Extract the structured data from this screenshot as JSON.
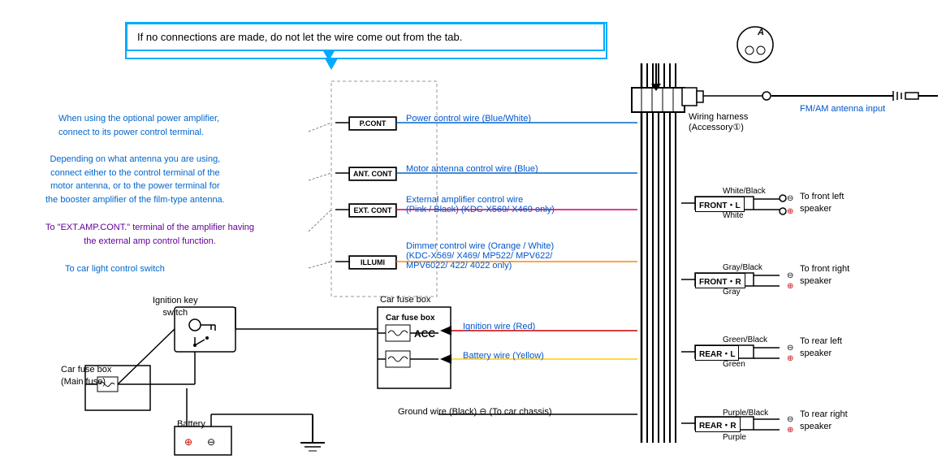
{
  "callout": {
    "text": "If no connections are made, do not let the wire come out from the tab."
  },
  "notes": {
    "note1": "When using the optional power amplifier,",
    "note1b": "connect to its power control terminal.",
    "note2": "Depending on what antenna you are using,",
    "note2b": "connect either to the control terminal of the",
    "note2c": "motor antenna, or to the power terminal for",
    "note2d": "the booster amplifier of the film-type antenna.",
    "note3": "To \"EXT.AMP.CONT.\" terminal of the amplifier having",
    "note3b": "the external amp control function.",
    "note4": "To car light control switch"
  },
  "wire_labels": {
    "power_control": "Power control wire (Blue/White)",
    "motor_antenna": "Motor antenna control wire (Blue)",
    "ext_amp": "External amplifier control wire",
    "ext_amp2": "(Pink / Black) (KDC-X569/ X469 only)",
    "dimmer": "Dimmer control wire (Orange / White)",
    "dimmer2": "(KDC-X569/ X469/ MP522/ MPV622/",
    "dimmer3": "MPV6022/ 422/ 4022 only)",
    "ignition": "Ignition wire (Red)",
    "battery": "Battery wire (Yellow)",
    "ground": "Ground wire (Black) ⊖ (To car chassis)"
  },
  "connectors": {
    "pcont": "P.CONT",
    "antcont": "ANT.\nCONT",
    "extcont": "EXT.\nCONT",
    "illumi": "ILLUMI",
    "acc": "ACC",
    "front_l": "FRONT・L",
    "front_r": "FRONT・R",
    "rear_l": "REAR・L",
    "rear_r": "REAR・R"
  },
  "wiring_harness": {
    "label": "Wiring harness",
    "label2": "(Accessory①)"
  },
  "antenna": {
    "label": "FM/AM antenna input"
  },
  "speakers": {
    "front_left": "To front left\nspeaker",
    "front_right": "To front right\nspeaker",
    "rear_left": "To rear left\nspeaker",
    "rear_right": "To rear right\nspeaker"
  },
  "wire_colors": {
    "front_l_neg": "White/Black",
    "front_l_pos": "White",
    "front_r_neg": "Gray/Black",
    "front_r_pos": "Gray",
    "rear_l_neg": "Green/Black",
    "rear_l_pos": "Green",
    "rear_r_neg": "Purple/Black",
    "rear_r_pos": "Purple"
  },
  "other_labels": {
    "ignition_key": "Ignition key",
    "ignition_key2": "switch",
    "car_fuse_box": "Car fuse box",
    "car_fuse_box2": "(Main fuse)",
    "car_fuse_box_main": "Car fuse box",
    "battery": "Battery",
    "a_label": "A"
  }
}
